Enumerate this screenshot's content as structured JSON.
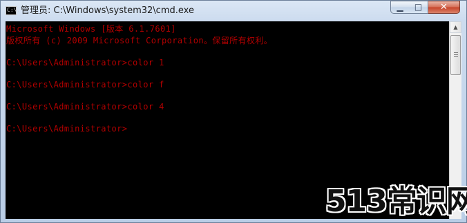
{
  "window": {
    "app_icon_text": "C:\\.",
    "title": "管理员: C:\\Windows\\system32\\cmd.exe",
    "controls": {
      "minimize": "▁",
      "maximize": "□",
      "close": "✕"
    }
  },
  "console": {
    "lines": [
      "Microsoft Windows [版本 6.1.7601]",
      "版权所有 (c) 2009 Microsoft Corporation。保留所有权利。",
      "",
      "C:\\Users\\Administrator>color 1",
      "",
      "C:\\Users\\Administrator>color f",
      "",
      "C:\\Users\\Administrator>color 4",
      "",
      "C:\\Users\\Administrator>"
    ],
    "text_color": "#b40000",
    "background_color": "#000000"
  },
  "scrollbar": {
    "up_arrow": "▲",
    "down_arrow": "▼"
  },
  "watermark": {
    "text": "513常识网"
  }
}
